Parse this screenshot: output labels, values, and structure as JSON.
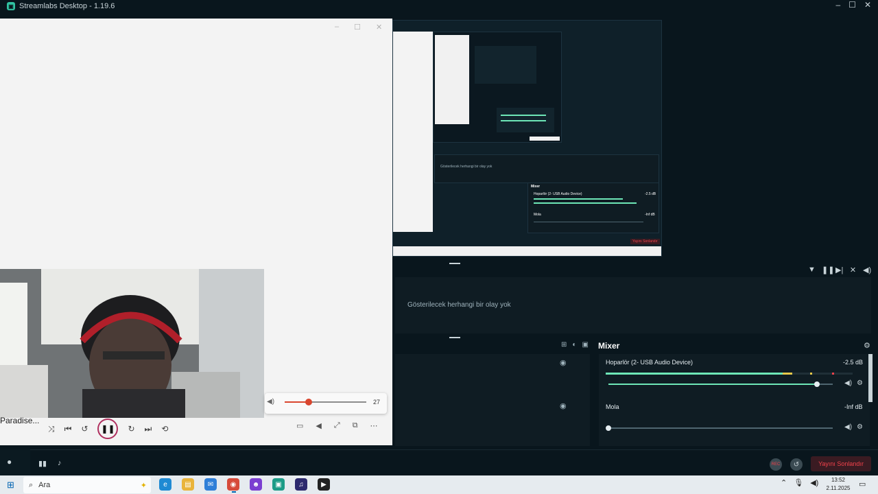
{
  "app": {
    "title": "Streamlabs Desktop - 1.19.6"
  },
  "window_controls": {
    "minimize": "–",
    "maximize": "☐",
    "close": "✕"
  },
  "events": {
    "empty_text": "Gösterilecek herhangi bir olay yok"
  },
  "mixer": {
    "title": "Mixer",
    "channels": [
      {
        "name": "Hoparlör (2- USB Audio Device)",
        "level": "-2.5 dB",
        "volume": 0.92
      },
      {
        "name": "Mola",
        "level": "-Inf dB",
        "volume": 0.0
      }
    ]
  },
  "bottom": {
    "end_stream_label": "Yayını Sonlandır",
    "rec_label": "REC"
  },
  "player": {
    "song_title": "Paradise...",
    "volume_value": "27",
    "volume_fraction": 0.27
  },
  "taskbar": {
    "search_placeholder": "Ara",
    "time": "13:52",
    "date": "2.11.2025"
  },
  "nested_preview": {
    "events_empty_text": "Gösterilecek herhangi bir olay yok",
    "mixer_title": "Mixer",
    "ch1_name": "Hoparlör (2- USB Audio Device)",
    "ch1_level": "-2.5 dB",
    "ch2_name": "Mola",
    "ch2_level": "-Inf dB",
    "end_label": "Yayını Sonlandır"
  },
  "colors": {
    "accent": "#31c3a2",
    "meter_green": "#6ee7b7",
    "meter_yellow": "#e6c84a",
    "danger": "#f2424b",
    "player_accent": "#d9462e"
  }
}
